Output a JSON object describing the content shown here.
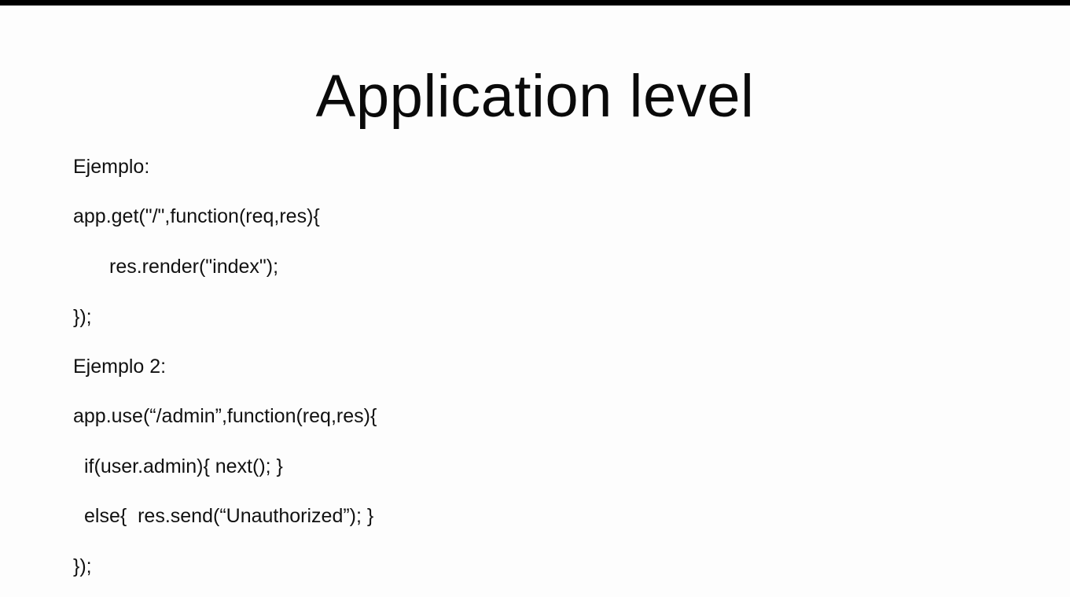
{
  "slide": {
    "title": "Application level",
    "lines": [
      "Ejemplo:",
      "app.get(\"/\",function(req,res){",
      "res.render(\"index\");",
      "});",
      "Ejemplo 2:",
      "app.use(“/admin”,function(req,res){",
      "if(user.admin){ next(); }",
      "else{  res.send(“Unauthorized”); }",
      "});"
    ]
  }
}
